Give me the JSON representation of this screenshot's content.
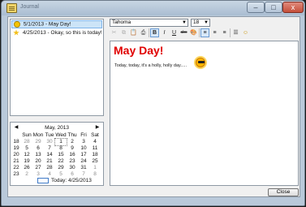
{
  "window": {
    "title": "Journal",
    "close_label": "x"
  },
  "entries": [
    {
      "date": "5/1/2013",
      "title": "May Day!",
      "icon": "smiley-icon",
      "selected": true
    },
    {
      "date": "4/25/2013",
      "title": "Okay, so this is today!",
      "icon": "star-icon",
      "selected": false
    }
  ],
  "calendar": {
    "month_label": "May, 2013",
    "prev": "◀",
    "next": "▶",
    "day_headers": [
      "Sun",
      "Mon",
      "Tue",
      "Wed",
      "Thu",
      "Fri",
      "Sat"
    ],
    "weeks": [
      {
        "week": "18",
        "days": [
          "28",
          "29",
          "30",
          "1",
          "2",
          "3",
          "4"
        ]
      },
      {
        "week": "19",
        "days": [
          "5",
          "6",
          "7",
          "8",
          "9",
          "10",
          "11"
        ]
      },
      {
        "week": "20",
        "days": [
          "12",
          "13",
          "14",
          "15",
          "16",
          "17",
          "18"
        ]
      },
      {
        "week": "21",
        "days": [
          "19",
          "20",
          "21",
          "22",
          "23",
          "24",
          "25"
        ]
      },
      {
        "week": "22",
        "days": [
          "26",
          "27",
          "28",
          "29",
          "30",
          "31",
          "1"
        ]
      },
      {
        "week": "23",
        "days": [
          "2",
          "3",
          "4",
          "5",
          "6",
          "7",
          "8"
        ]
      }
    ],
    "today_label": "Today: 4/25/2013"
  },
  "toolbar": {
    "font": "Tahoma",
    "size": "18",
    "buttons": [
      {
        "name": "cut-icon",
        "glyph": "✂",
        "disabled": true
      },
      {
        "name": "copy-icon",
        "glyph": "⧉",
        "disabled": true
      },
      {
        "name": "paste-icon",
        "glyph": "📋",
        "disabled": false
      },
      {
        "name": "print-icon",
        "glyph": "⎙",
        "disabled": false
      },
      {
        "name": "bold-button",
        "glyph": "B",
        "active": true
      },
      {
        "name": "italic-button",
        "glyph": "I",
        "active": false
      },
      {
        "name": "underline-button",
        "glyph": "U",
        "active": false
      },
      {
        "name": "strikethrough-button",
        "glyph": "abc",
        "active": false
      },
      {
        "name": "color-icon",
        "glyph": "🎨",
        "active": false
      },
      {
        "name": "align-left-button",
        "glyph": "≡",
        "active": true
      },
      {
        "name": "align-center-button",
        "glyph": "≡",
        "active": false
      },
      {
        "name": "align-right-button",
        "glyph": "≡",
        "active": false
      },
      {
        "name": "bullet-list-button",
        "glyph": "☰",
        "active": false
      },
      {
        "name": "emoticon-button",
        "glyph": "☺",
        "active": false
      }
    ]
  },
  "editor": {
    "title": "May Day!",
    "body": "Today, today, it's a holly, holly day....."
  },
  "footer": {
    "close_label": "Close"
  }
}
